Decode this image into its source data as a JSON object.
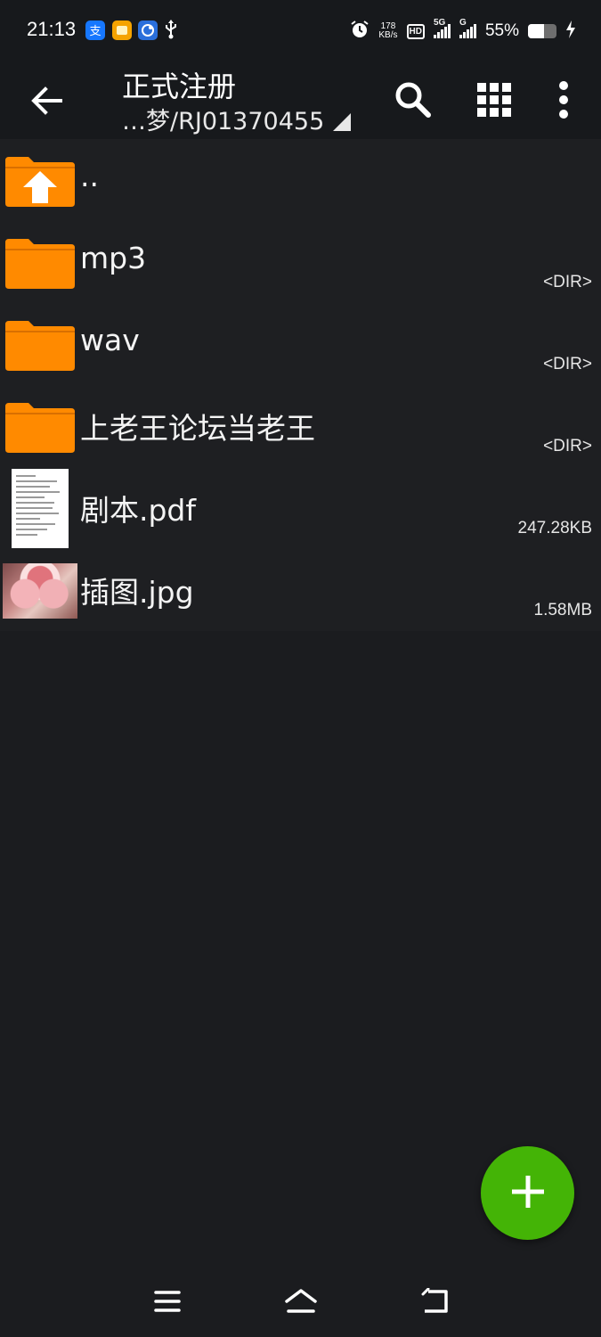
{
  "status_bar": {
    "time": "21:13",
    "net_speed_value": "178",
    "net_speed_unit": "KB/s",
    "hd_label": "HD",
    "sig1_label": "5G",
    "sig2_label": "G",
    "battery_percent": "55%",
    "battery_level": 0.55,
    "icons": [
      "alipay-icon",
      "notes-app-icon",
      "browser-app-icon",
      "usb-icon",
      "alarm-icon",
      "signal-icon",
      "battery-icon",
      "charging-icon"
    ],
    "colors": {
      "alipay": "#1677ff",
      "notes": "#f5a300",
      "browser": "#2a6fdb"
    }
  },
  "toolbar": {
    "title": "正式注册",
    "path": "…梦/RJ01370455",
    "icons": [
      "back-arrow-icon",
      "search-icon",
      "grid-view-icon",
      "more-vert-icon"
    ]
  },
  "files": [
    {
      "name": "..",
      "meta": "",
      "icon": "parent-folder-icon"
    },
    {
      "name": "mp3",
      "meta": "<DIR>",
      "icon": "folder-icon"
    },
    {
      "name": "wav",
      "meta": "<DIR>",
      "icon": "folder-icon"
    },
    {
      "name": "上老王论坛当老王",
      "meta": "<DIR>",
      "icon": "folder-icon"
    },
    {
      "name": "剧本.pdf",
      "meta": "247.28KB",
      "icon": "pdf-thumbnail"
    },
    {
      "name": "插图.jpg",
      "meta": "1.58MB",
      "icon": "image-thumbnail"
    }
  ],
  "fab": {
    "icon": "plus-icon",
    "color": "#44b406"
  },
  "navbar": {
    "icons": [
      "menu-icon",
      "home-icon",
      "back-icon"
    ]
  },
  "colors": {
    "folder": "#ff8a00",
    "background": "#1b1c1f",
    "list_background": "#1e1f22"
  }
}
